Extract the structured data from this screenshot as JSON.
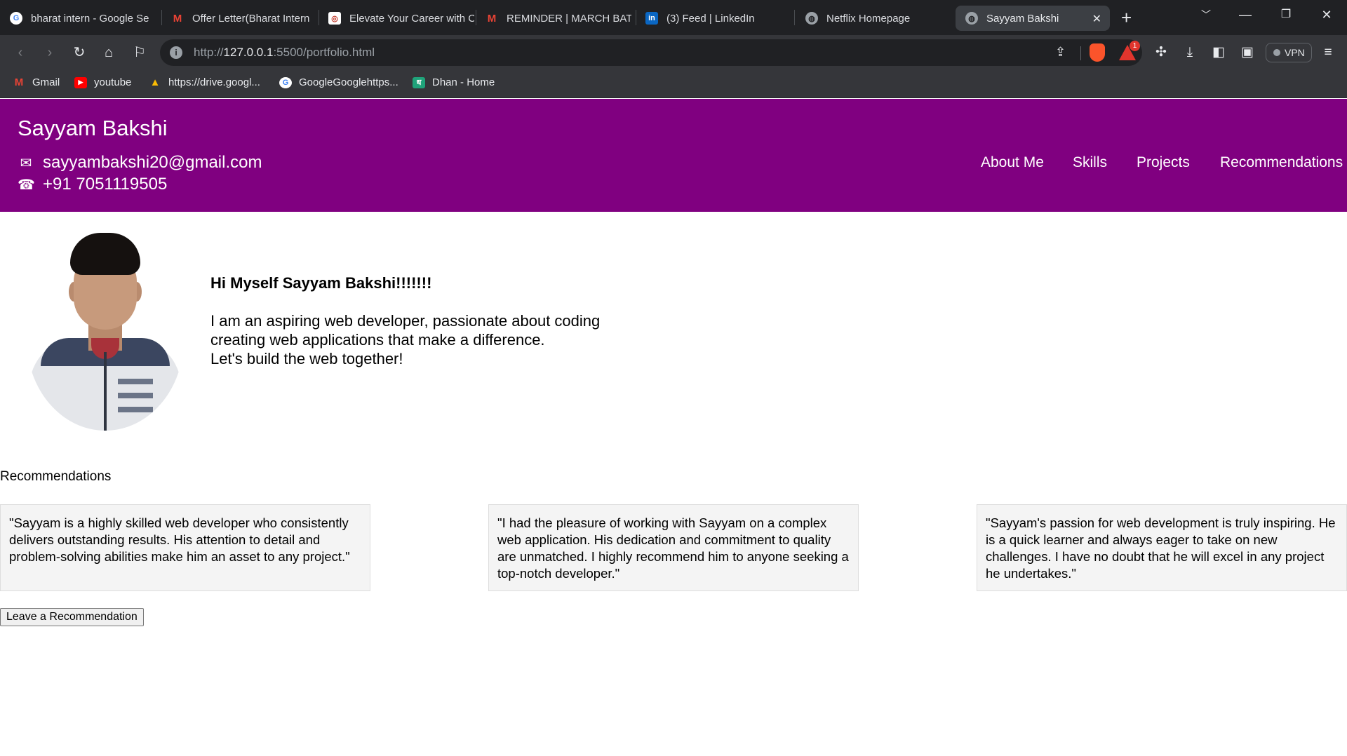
{
  "browser": {
    "tabs": [
      {
        "title": "bharat intern - Google Se",
        "icon": "google-icon"
      },
      {
        "title": "Offer Letter(Bharat Intern",
        "icon": "gmail-icon"
      },
      {
        "title": "Elevate Your Career with C",
        "icon": "site-icon"
      },
      {
        "title": "REMINDER | MARCH BATC",
        "icon": "gmail-icon"
      },
      {
        "title": "(3) Feed | LinkedIn",
        "icon": "linkedin-icon"
      },
      {
        "title": "Netflix Homepage",
        "icon": "globe-icon"
      },
      {
        "title": "Sayyam Bakshi",
        "icon": "globe-icon",
        "active": true
      }
    ],
    "url": {
      "prefix": "http://",
      "host": "127.0.0.1",
      "rest": ":5500/portfolio.html"
    },
    "rewards_badge": "1",
    "vpn_label": "VPN",
    "bookmarks": [
      {
        "label": "Gmail",
        "icon": "gmail-icon"
      },
      {
        "label": "youtube",
        "icon": "youtube-icon"
      },
      {
        "label": "https://drive.googl...",
        "icon": "drive-icon"
      },
      {
        "label": "GoogleGooglehttps...",
        "icon": "google-icon"
      },
      {
        "label": "Dhan - Home",
        "icon": "dhan-icon"
      }
    ]
  },
  "header": {
    "name": "Sayyam Bakshi",
    "email": "sayyambakshi20@gmail.com",
    "phone": "+91 7051119505",
    "nav": [
      "About Me",
      "Skills",
      "Projects",
      "Recommendations"
    ],
    "background_color": "#800080"
  },
  "intro": {
    "greeting": "Hi Myself Sayyam Bakshi!!!!!!!",
    "lines": [
      "I am an aspiring web developer, passionate about coding",
      "creating web applications that make a difference.",
      "Let's build the web together!"
    ]
  },
  "recommendations": {
    "heading": "Recommendations",
    "items": [
      "\"Sayyam is a highly skilled web developer who consistently delivers outstanding results. His attention to detail and problem-solving abilities make him an asset to any project.\"",
      "\"I had the pleasure of working with Sayyam on a complex web application. His dedication and commitment to quality are unmatched. I highly recommend him to anyone seeking a top-notch developer.\"",
      "\"Sayyam's passion for web development is truly inspiring. He is a quick learner and always eager to take on new challenges. I have no doubt that he will excel in any project he undertakes.\""
    ],
    "button_label": "Leave a Recommendation"
  }
}
